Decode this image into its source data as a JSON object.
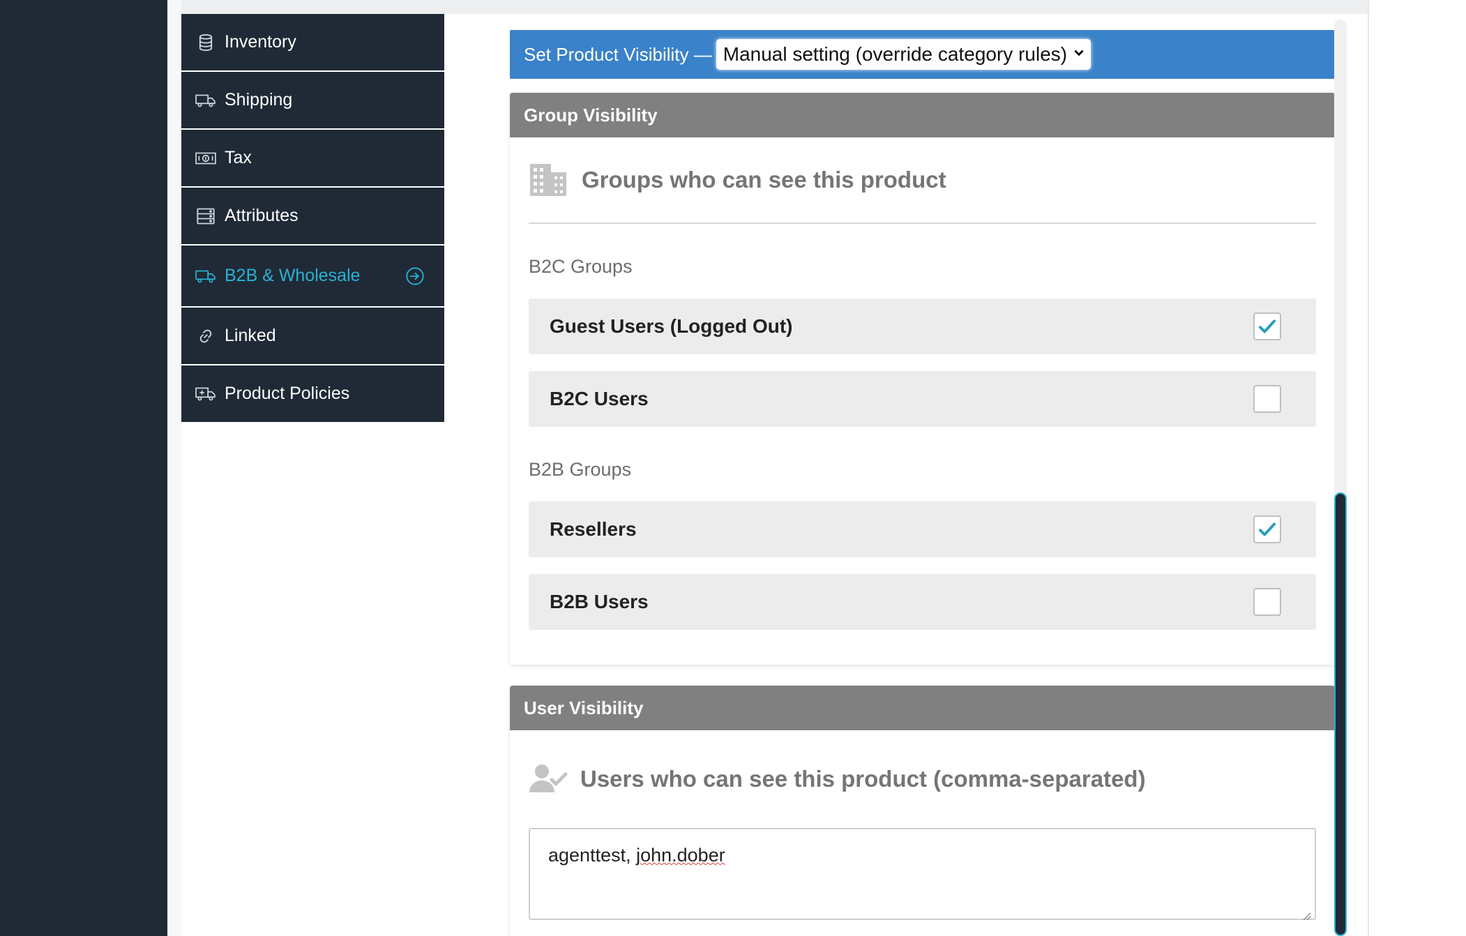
{
  "sidebar": {
    "items": [
      {
        "label": "Inventory",
        "icon": "database-icon"
      },
      {
        "label": "Shipping",
        "icon": "truck-icon"
      },
      {
        "label": "Tax",
        "icon": "money-icon"
      },
      {
        "label": "Attributes",
        "icon": "attributes-icon"
      },
      {
        "label": "B2B & Wholesale",
        "icon": "delivery-truck-icon",
        "active": true
      },
      {
        "label": "Linked",
        "icon": "link-icon"
      },
      {
        "label": "Product Policies",
        "icon": "policy-truck-icon"
      }
    ],
    "active_color": "#2ab1d3"
  },
  "visibility": {
    "label": "Set Product Visibility —",
    "selected_option": "Manual setting (override category rules)"
  },
  "group_card": {
    "header": "Group Visibility",
    "title": "Groups who can see this product",
    "b2c_label": "B2C Groups",
    "b2c_groups": [
      {
        "name": "Guest Users (Logged Out)",
        "checked": true
      },
      {
        "name": "B2C Users",
        "checked": false
      }
    ],
    "b2b_label": "B2B Groups",
    "b2b_groups": [
      {
        "name": "Resellers",
        "checked": true
      },
      {
        "name": "B2B Users",
        "checked": false
      }
    ]
  },
  "user_card": {
    "header": "User Visibility",
    "title": "Users who can see this product (comma-separated)",
    "value_part1": "agenttest, ",
    "value_part2": "john.dober"
  },
  "colors": {
    "header_blue": "#3a82c9",
    "card_header_gray": "#808080",
    "check_teal": "#2a9fb8",
    "dark": "#1f2a36"
  }
}
